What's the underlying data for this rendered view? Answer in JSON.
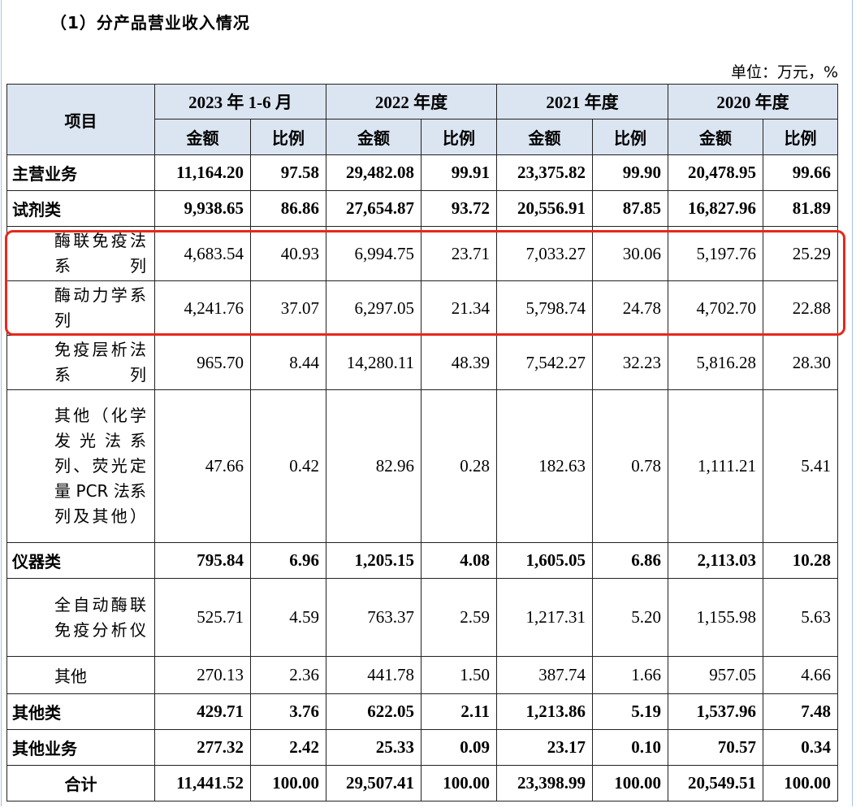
{
  "heading": "（1）分产品营业收入情况",
  "unit": "单位：万元，%",
  "header": {
    "item": "项目",
    "periods": [
      "2023 年 1-6 月",
      "2022 年度",
      "2021 年度",
      "2020 年度"
    ],
    "amount": "金额",
    "ratio": "比例"
  },
  "rows": [
    {
      "label": "主营业务",
      "values": [
        "11,164.20",
        "97.58",
        "29,482.08",
        "99.91",
        "23,375.82",
        "99.90",
        "20,478.95",
        "99.66"
      ]
    },
    {
      "label": "试剂类",
      "values": [
        "9,938.65",
        "86.86",
        "27,654.87",
        "93.72",
        "20,556.91",
        "87.85",
        "16,827.96",
        "81.89"
      ]
    },
    {
      "label": "酶联免疫法系列",
      "values": [
        "4,683.54",
        "40.93",
        "6,994.75",
        "23.71",
        "7,033.27",
        "30.06",
        "5,197.76",
        "25.29"
      ]
    },
    {
      "label": "酶动力学系列",
      "values": [
        "4,241.76",
        "37.07",
        "6,297.05",
        "21.34",
        "5,798.74",
        "24.78",
        "4,702.70",
        "22.88"
      ]
    },
    {
      "label": "免疫层析法系列",
      "values": [
        "965.70",
        "8.44",
        "14,280.11",
        "48.39",
        "7,542.27",
        "32.23",
        "5,816.28",
        "28.30"
      ]
    },
    {
      "label": "其他（化学发光法系列、荧光定量 PCR 法系列及其他）",
      "values": [
        "47.66",
        "0.42",
        "82.96",
        "0.28",
        "182.63",
        "0.78",
        "1,111.21",
        "5.41"
      ]
    },
    {
      "label": "仪器类",
      "values": [
        "795.84",
        "6.96",
        "1,205.15",
        "4.08",
        "1,605.05",
        "6.86",
        "2,113.03",
        "10.28"
      ]
    },
    {
      "label": "全自动酶联免疫分析仪",
      "values": [
        "525.71",
        "4.59",
        "763.37",
        "2.59",
        "1,217.31",
        "5.20",
        "1,155.98",
        "5.63"
      ]
    },
    {
      "label": "其他",
      "values": [
        "270.13",
        "2.36",
        "441.78",
        "1.50",
        "387.74",
        "1.66",
        "957.05",
        "4.66"
      ]
    },
    {
      "label": "其他类",
      "values": [
        "429.71",
        "3.76",
        "622.05",
        "2.11",
        "1,213.86",
        "5.19",
        "1,537.96",
        "7.48"
      ]
    },
    {
      "label": "其他业务",
      "values": [
        "277.32",
        "2.42",
        "25.33",
        "0.09",
        "23.17",
        "0.10",
        "70.57",
        "0.34"
      ]
    },
    {
      "label": "合计",
      "values": [
        "11,441.52",
        "100.00",
        "29,507.41",
        "100.00",
        "23,398.99",
        "100.00",
        "20,549.51",
        "100.00"
      ]
    }
  ]
}
